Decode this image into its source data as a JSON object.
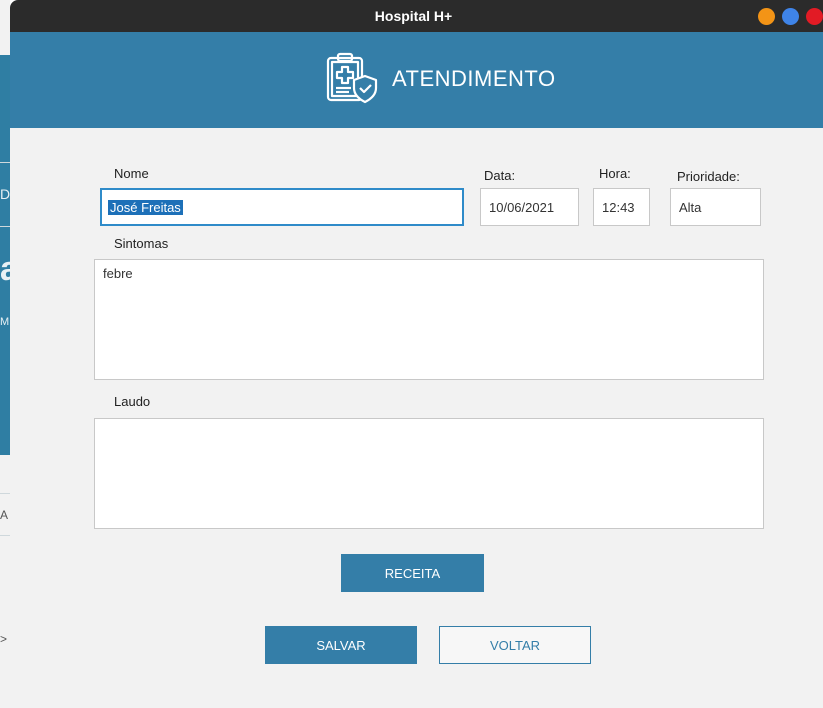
{
  "window": {
    "title": "Hospital H+"
  },
  "header": {
    "title": "ATENDIMENTO",
    "icon": "clipboard-medical-shield-icon"
  },
  "background_window": {
    "fragments": [
      "De",
      "a",
      "M",
      "A",
      ">"
    ]
  },
  "form": {
    "name": {
      "label": "Nome",
      "value": "José Freitas"
    },
    "date": {
      "label": "Data:",
      "value": "10/06/2021"
    },
    "time": {
      "label": "Hora:",
      "value": "12:43"
    },
    "priority": {
      "label": "Prioridade:",
      "value": "Alta"
    },
    "symptoms": {
      "label": "Sintomas",
      "value": "febre"
    },
    "report": {
      "label": "Laudo",
      "value": ""
    }
  },
  "buttons": {
    "prescription": "RECEITA",
    "save": "SALVAR",
    "back": "VOLTAR"
  },
  "colors": {
    "accent": "#347ea8",
    "titlebar": "#2b2b2b",
    "minimize": "#f39416",
    "maximize": "#3f84e8",
    "close": "#e21b25",
    "selection": "#1d70b8"
  }
}
